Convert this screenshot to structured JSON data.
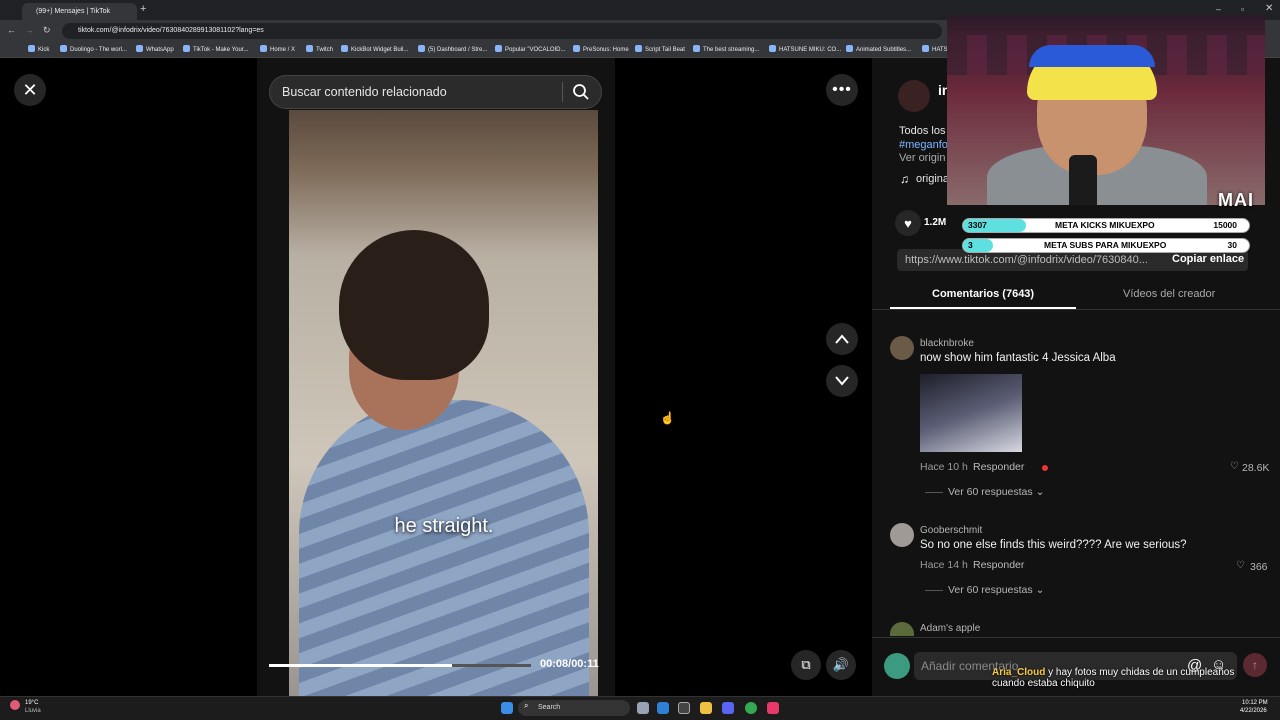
{
  "browser": {
    "tab_title": "(99+) Mensajes | TikTok",
    "url": "tiktok.com/@infodrix/video/7630840289913081102?lang=es",
    "bookmarks": [
      "Kick",
      "Duolingo - The worl...",
      "WhatsApp",
      "TikTok - Make Your...",
      "Home / X",
      "Twitch",
      "KickBot Widget Buil...",
      "(5) Dashboard / Stre...",
      "Popular \"VOCALOID...",
      "PreSonus: Home",
      "Script Tail Beat",
      "The best streaming...",
      "HATSUNE MIKU: CO...",
      "Animated Subtitles...",
      "HATS"
    ]
  },
  "video": {
    "search_placeholder": "Buscar contenido relacionado",
    "subtitle": "he straight.",
    "time": "00:08/00:11",
    "progress_fraction": 0.7
  },
  "post": {
    "author_partial": "in",
    "desc_line1": "Todos los",
    "hashtag_partial": "#meganfo",
    "see_more": "Ver origin",
    "sound_partial": "origina",
    "likes": "1.2M",
    "link": "https://www.tiktok.com/@infodrix/video/7630840...",
    "copy_link": "Copiar enlace"
  },
  "tabs": {
    "comments": "Comentarios (7643)",
    "creator_videos": "Vídeos del creador"
  },
  "comments": [
    {
      "user": "blacknbroke",
      "text": "now show him fantastic 4 Jessica Alba",
      "time": "Hace 10 h",
      "reply": "Responder",
      "likes": "28.6K",
      "replies": "Ver 60 respuestas"
    },
    {
      "user": "Gooberschmit",
      "text": "So no one else finds this weird???? Are we serious?",
      "time": "Hace 14 h",
      "reply": "Responder",
      "likes": "366",
      "replies": "Ver 60 respuestas"
    },
    {
      "user": "Adam's apple"
    }
  ],
  "comment_input_placeholder": "Añadir comentario...",
  "stream_overlay": {
    "brand": "MAI",
    "goal1": {
      "label": "META KICKS MIKUEXPO",
      "current": "3307",
      "target": "15000",
      "fraction": 0.22
    },
    "goal2": {
      "label": "META SUBS PARA MIKUEXPO",
      "current": "3",
      "target": "30",
      "fraction": 0.1
    },
    "chat_user": "Aria_Cloud",
    "chat_text": "y hay fotos muy chidas de un cumpleaños cuando estaba chiquito"
  },
  "taskbar": {
    "weather_temp": "19°C",
    "weather_desc": "Lluvia",
    "search": "Search",
    "clock_time": "10:12 PM",
    "clock_date": "4/22/2026"
  }
}
